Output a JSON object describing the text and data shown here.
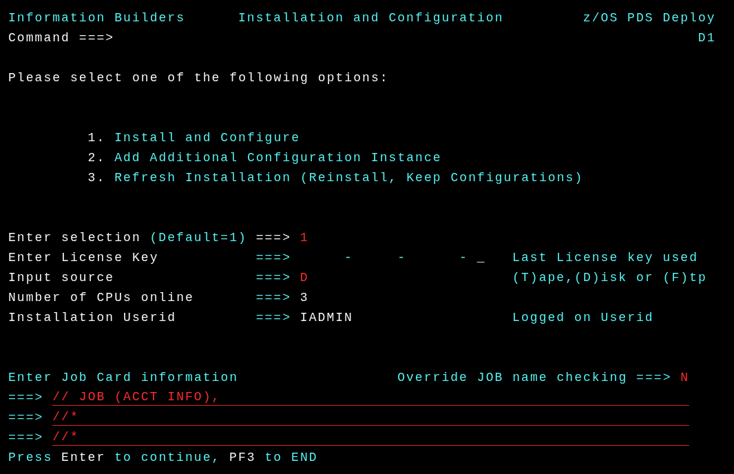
{
  "header": {
    "left": "Information Builders",
    "center": "Installation and Configuration",
    "right": "z/OS PDS Deploy"
  },
  "command": {
    "label": "Command ===>",
    "panel_id": "D1"
  },
  "instruction": "Please select one of the following options:",
  "options": [
    {
      "number": "1.",
      "label": "Install and Configure"
    },
    {
      "number": "2.",
      "label": "Add Additional Configuration Instance"
    },
    {
      "number": "3.",
      "label": "Refresh Installation (Reinstall, Keep Configurations)"
    }
  ],
  "fields": [
    {
      "kind": "selection",
      "label": "Enter selection",
      "note": "(Default=1)",
      "prompt": "===>",
      "prompt_bright": true,
      "value": "1",
      "editable": true
    },
    {
      "kind": "license",
      "label": "Enter License Key",
      "prompt": "===>",
      "prompt_bright": false,
      "separators": [
        "-",
        "-",
        "-"
      ],
      "cursor": "_",
      "help": "Last License key used"
    },
    {
      "kind": "text",
      "label": "Input source",
      "prompt": "===>",
      "prompt_bright": false,
      "value": "D",
      "editable": true,
      "help": "(T)ape,(D)isk or (F)tp"
    },
    {
      "kind": "text",
      "label": "Number of CPUs online",
      "prompt": "===>",
      "prompt_bright": false,
      "value": "3",
      "editable": false
    },
    {
      "kind": "text",
      "label": "Installation Userid",
      "prompt": "===>",
      "prompt_bright": false,
      "value": "IADMIN",
      "editable": false,
      "help": "Logged on Userid"
    }
  ],
  "job_card": {
    "title": "Enter Job Card information",
    "override_label": "Override JOB name checking ===>",
    "override_value": "N",
    "lines": [
      {
        "prompt": "===>",
        "value": "// JOB (ACCT INFO),"
      },
      {
        "prompt": "===>",
        "value": "//*"
      },
      {
        "prompt": "===>",
        "value": "//*"
      }
    ]
  },
  "footer": [
    {
      "text": "Press",
      "bright": false
    },
    {
      "text": "Enter",
      "bright": true
    },
    {
      "text": "to continue,",
      "bright": false
    },
    {
      "text": "PF3",
      "bright": true
    },
    {
      "text": "to END",
      "bright": false
    }
  ]
}
